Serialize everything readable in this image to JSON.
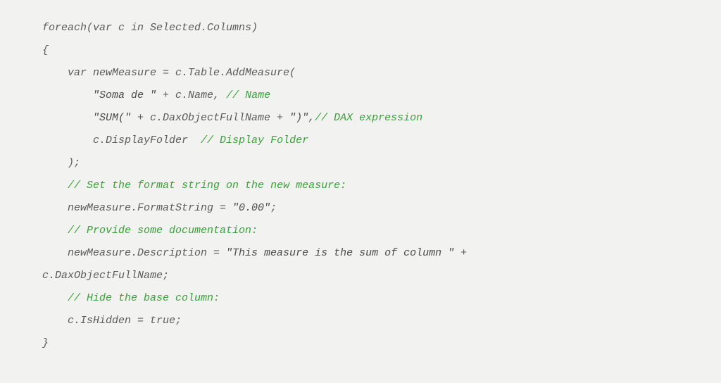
{
  "code": {
    "l1_a": "foreach(var c in Selected.Columns)",
    "l2_a": "{",
    "l3_a": "    var newMeasure = c.Table.AddMeasure(",
    "l4_a": "        ",
    "l4_s": "\"Soma de \"",
    "l4_b": " + c.Name, ",
    "l4_c": "// Name",
    "l5_a": "        ",
    "l5_s1": "\"SUM(\"",
    "l5_b": " + c.DaxObjectFullName + ",
    "l5_s2": "\")\"",
    "l5_c": ",",
    "l5_d": "// DAX expression",
    "l6_a": "        c.DisplayFolder  ",
    "l6_c": "// Display Folder",
    "l7_a": "    );",
    "l8_a": "    ",
    "l8_c": "// Set the format string on the new measure:",
    "l9_a": "    newMeasure.FormatString = ",
    "l9_s": "\"0.00\"",
    "l9_b": ";",
    "l10_a": "    ",
    "l10_c": "// Provide some documentation:",
    "l11_a": "    newMeasure.Description = ",
    "l11_s": "\"This measure is the sum of column \"",
    "l11_b": " + ",
    "l11_2": "c.DaxObjectFullName;",
    "l12_a": "    ",
    "l12_c": "// Hide the base column:",
    "l13_a": "    c.IsHidden = true;",
    "l14_a": "}"
  }
}
